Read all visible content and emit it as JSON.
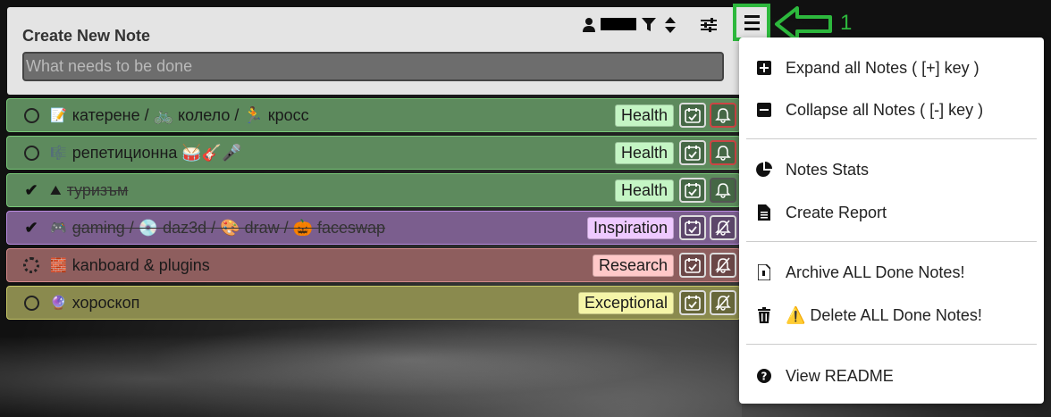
{
  "header": {
    "title": "Create New Note",
    "placeholder": "What needs to be done"
  },
  "annotation": {
    "number": "1"
  },
  "notes": [
    {
      "emoji": "📝",
      "text": "катерене / 🚲 колело / 🏃 кросс",
      "tag": "Health",
      "done": false,
      "status": "circle",
      "bg": "#5d8a5d",
      "border": "#79c979",
      "tag_bg": "#c4f5c4"
    },
    {
      "emoji": "🎼",
      "text": "репетиционна 🥁🎸🎤",
      "tag": "Health",
      "done": false,
      "status": "circle",
      "bg": "#5d8a5d",
      "border": "#79c979",
      "tag_bg": "#c4f5c4"
    },
    {
      "emoji": "⛰",
      "text": "туризъм",
      "tag": "Health",
      "done": true,
      "status": "check",
      "bg": "#5d8a5d",
      "border": "#79c979",
      "tag_bg": "#c4f5c4"
    },
    {
      "emoji": "🎮",
      "text": "gaming / 💿 daz3d / 🎨 draw / 🎃 faceswap",
      "tag": "Inspiration",
      "done": true,
      "status": "check",
      "bg": "#7b5e8e",
      "border": "#b98be0",
      "tag_bg": "#eec9ff"
    },
    {
      "emoji": "🧱",
      "text": "kanboard & plugins",
      "tag": "Research",
      "done": false,
      "status": "spinner",
      "bg": "#8e5e5e",
      "border": "#d48a8a",
      "tag_bg": "#ffc9c9"
    },
    {
      "emoji": "🔮",
      "text": "хороскоп",
      "tag": "Exceptional",
      "done": false,
      "status": "circle",
      "bg": "#8a8a4e",
      "border": "#c9c968",
      "tag_bg": "#f5f5a8"
    }
  ],
  "menu": {
    "expand": "Expand all Notes ( [+] key )",
    "collapse": "Collapse all Notes ( [-] key )",
    "stats": "Notes Stats",
    "report": "Create Report",
    "archive": "Archive ALL Done Notes!",
    "delete": "⚠️ Delete ALL Done Notes!",
    "readme": "View README"
  },
  "colors": {
    "accent_annotation": "#2db83d"
  }
}
